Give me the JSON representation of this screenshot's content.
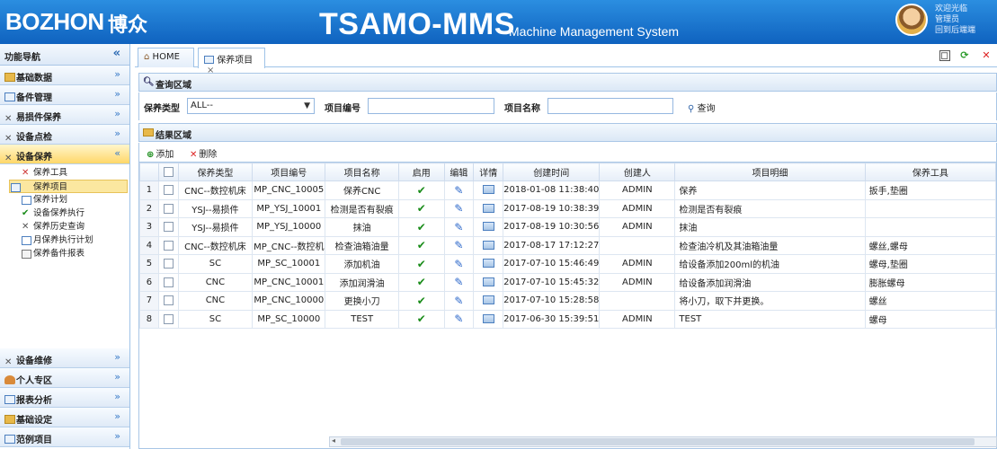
{
  "header": {
    "logo": "BOZHON",
    "logo_cn": "博众",
    "title": "TSAMO-MMS",
    "subtitle": "Machine Management System",
    "user_line1": "欢迎光临",
    "user_line2": "管理员",
    "user_line3": "回到后端端"
  },
  "sidebar": {
    "title": "功能导航",
    "sections_top": [
      {
        "label": "基础数据"
      },
      {
        "label": "备件管理"
      },
      {
        "label": "易损件保养"
      },
      {
        "label": "设备点检"
      },
      {
        "label": "设备保养"
      }
    ],
    "sub_items": [
      {
        "label": "保养工具"
      },
      {
        "label": "保养项目"
      },
      {
        "label": "保养计划"
      },
      {
        "label": "设备保养执行"
      },
      {
        "label": "保养历史查询"
      },
      {
        "label": "月保养执行计划"
      },
      {
        "label": "保养备件报表"
      }
    ],
    "sections_bottom": [
      {
        "label": "设备维修"
      },
      {
        "label": "个人专区"
      },
      {
        "label": "报表分析"
      },
      {
        "label": "基础设定"
      },
      {
        "label": "范例项目"
      }
    ]
  },
  "tabs": [
    {
      "label": "HOME"
    },
    {
      "label": "保养项目"
    }
  ],
  "query": {
    "title": "查询区域",
    "type_label": "保养类型",
    "type_value": "ALL--",
    "code_label": "项目编号",
    "name_label": "项目名称",
    "search_label": "查询"
  },
  "results": {
    "title": "结果区域",
    "add_label": "添加",
    "delete_label": "删除"
  },
  "grid": {
    "columns": [
      "",
      "",
      "保养类型",
      "项目编号",
      "项目名称",
      "启用",
      "编辑",
      "详情",
      "创建时间",
      "创建人",
      "项目明细",
      "保养工具"
    ],
    "rows": [
      {
        "n": "1",
        "type": "CNC--数控机床",
        "code": "MP_CNC_10005",
        "name": "保养CNC",
        "time": "2018-01-08 11:38:40",
        "creator": "ADMIN",
        "detail": "保养",
        "tool": "扳手,垫圈"
      },
      {
        "n": "2",
        "type": "YSJ--易损件",
        "code": "MP_YSJ_10001",
        "name": "检测是否有裂痕",
        "time": "2017-08-19 10:38:39",
        "creator": "ADMIN",
        "detail": "检测是否有裂痕",
        "tool": ""
      },
      {
        "n": "3",
        "type": "YSJ--易损件",
        "code": "MP_YSJ_10000",
        "name": "抹油",
        "time": "2017-08-19 10:30:56",
        "creator": "ADMIN",
        "detail": "抹油",
        "tool": ""
      },
      {
        "n": "4",
        "type": "CNC--数控机床",
        "code": "MP_CNC--数控机",
        "name": "检查油箱油量",
        "time": "2017-08-17 17:12:27",
        "creator": "",
        "detail": "检查油冷机及其油箱油量",
        "tool": "螺丝,螺母"
      },
      {
        "n": "5",
        "type": "SC",
        "code": "MP_SC_10001",
        "name": "添加机油",
        "time": "2017-07-10 15:46:49",
        "creator": "ADMIN",
        "detail": "给设备添加200ml的机油",
        "tool": "螺母,垫圈"
      },
      {
        "n": "6",
        "type": "CNC",
        "code": "MP_CNC_10001",
        "name": "添加润滑油",
        "time": "2017-07-10 15:45:32",
        "creator": "ADMIN",
        "detail": "给设备添加润滑油",
        "tool": "膨胀螺母"
      },
      {
        "n": "7",
        "type": "CNC",
        "code": "MP_CNC_10000",
        "name": "更换小刀",
        "time": "2017-07-10 15:28:58",
        "creator": "",
        "detail": "将小刀，取下并更换。",
        "tool": "螺丝"
      },
      {
        "n": "8",
        "type": "SC",
        "code": "MP_SC_10000",
        "name": "TEST",
        "time": "2017-06-30 15:39:51",
        "creator": "ADMIN",
        "detail": "TEST",
        "tool": "螺母"
      }
    ]
  }
}
